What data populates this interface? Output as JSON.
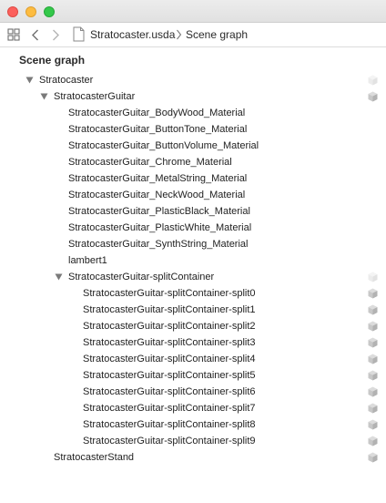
{
  "window": {
    "traffic_lights": [
      "close",
      "minimize",
      "zoom"
    ],
    "colors": {
      "close": "#fc605c",
      "minimize": "#fdbc40",
      "zoom": "#34c84a"
    }
  },
  "pathbar": {
    "file_name": "Stratocaster.usda",
    "section": "Scene graph",
    "icons": [
      "grid-icon",
      "back-icon",
      "forward-icon",
      "document-icon",
      "chevron-right-icon"
    ]
  },
  "scene_graph": {
    "title": "Scene graph",
    "rows": [
      {
        "label": "Stratocaster",
        "depth": 0,
        "expanded": true,
        "cube": "faded"
      },
      {
        "label": "StratocasterGuitar",
        "depth": 1,
        "expanded": true,
        "cube": "normal"
      },
      {
        "label": "StratocasterGuitar_BodyWood_Material",
        "depth": 2,
        "cube": "none"
      },
      {
        "label": "StratocasterGuitar_ButtonTone_Material",
        "depth": 2,
        "cube": "none"
      },
      {
        "label": "StratocasterGuitar_ButtonVolume_Material",
        "depth": 2,
        "cube": "none"
      },
      {
        "label": "StratocasterGuitar_Chrome_Material",
        "depth": 2,
        "cube": "none"
      },
      {
        "label": "StratocasterGuitar_MetalString_Material",
        "depth": 2,
        "cube": "none"
      },
      {
        "label": "StratocasterGuitar_NeckWood_Material",
        "depth": 2,
        "cube": "none"
      },
      {
        "label": "StratocasterGuitar_PlasticBlack_Material",
        "depth": 2,
        "cube": "none"
      },
      {
        "label": "StratocasterGuitar_PlasticWhite_Material",
        "depth": 2,
        "cube": "none"
      },
      {
        "label": "StratocasterGuitar_SynthString_Material",
        "depth": 2,
        "cube": "none"
      },
      {
        "label": "lambert1",
        "depth": 2,
        "cube": "none"
      },
      {
        "label": "StratocasterGuitar-splitContainer",
        "depth": 2,
        "expanded": true,
        "cube": "faded"
      },
      {
        "label": "StratocasterGuitar-splitContainer-split0",
        "depth": 3,
        "cube": "normal"
      },
      {
        "label": "StratocasterGuitar-splitContainer-split1",
        "depth": 3,
        "cube": "normal"
      },
      {
        "label": "StratocasterGuitar-splitContainer-split2",
        "depth": 3,
        "cube": "normal"
      },
      {
        "label": "StratocasterGuitar-splitContainer-split3",
        "depth": 3,
        "cube": "normal"
      },
      {
        "label": "StratocasterGuitar-splitContainer-split4",
        "depth": 3,
        "cube": "normal"
      },
      {
        "label": "StratocasterGuitar-splitContainer-split5",
        "depth": 3,
        "cube": "normal"
      },
      {
        "label": "StratocasterGuitar-splitContainer-split6",
        "depth": 3,
        "cube": "normal"
      },
      {
        "label": "StratocasterGuitar-splitContainer-split7",
        "depth": 3,
        "cube": "normal"
      },
      {
        "label": "StratocasterGuitar-splitContainer-split8",
        "depth": 3,
        "cube": "normal"
      },
      {
        "label": "StratocasterGuitar-splitContainer-split9",
        "depth": 3,
        "cube": "normal"
      },
      {
        "label": "StratocasterStand",
        "depth": 1,
        "cube": "normal"
      }
    ]
  }
}
